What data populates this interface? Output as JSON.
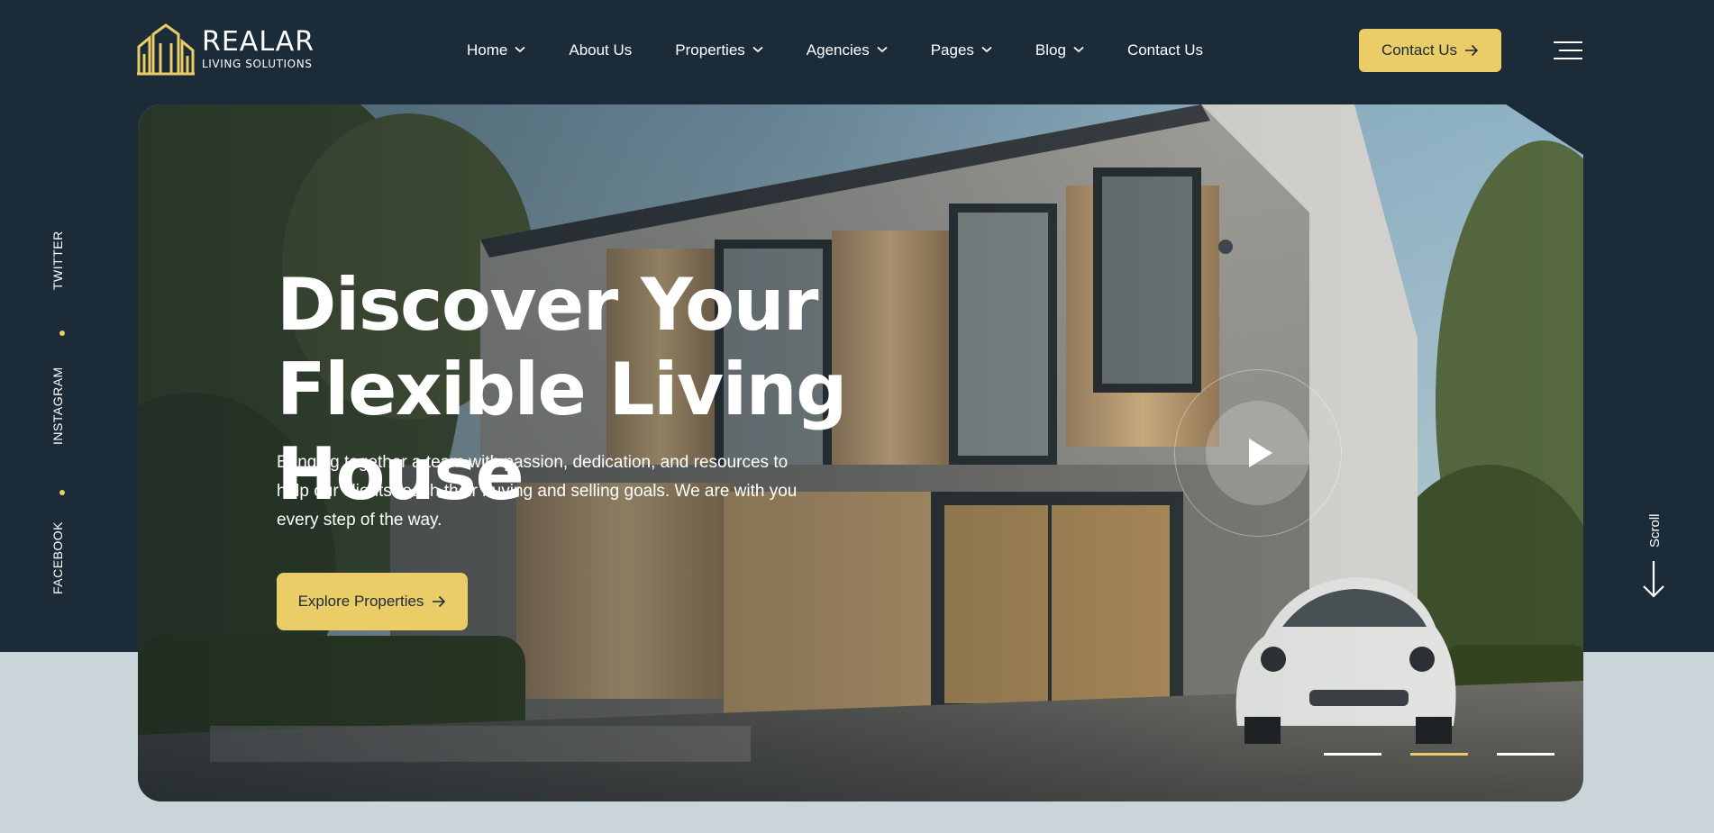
{
  "brand": {
    "name": "REALAR",
    "tagline": "LIVING SOLUTIONS",
    "accent_color": "#ebcd67",
    "dark_color": "#1b2b38"
  },
  "nav": {
    "items": [
      {
        "label": "Home",
        "has_dropdown": true
      },
      {
        "label": "About Us",
        "has_dropdown": false
      },
      {
        "label": "Properties",
        "has_dropdown": true
      },
      {
        "label": "Agencies",
        "has_dropdown": true
      },
      {
        "label": "Pages",
        "has_dropdown": true
      },
      {
        "label": "Blog",
        "has_dropdown": true
      },
      {
        "label": "Contact Us",
        "has_dropdown": false
      }
    ]
  },
  "header": {
    "cta_label": "Contact Us",
    "cta_icon": "arrow-right-icon",
    "menu_icon": "hamburger-menu-icon"
  },
  "social": {
    "links": [
      "TWITTER",
      "INSTAGRAM",
      "FACEBOOK"
    ]
  },
  "hero": {
    "title_line1": "Discover Your",
    "title_line2": "Flexible Living House",
    "description": "Bringing together a team with passion, dedication, and resources to help our clients reach their buying and selling goals. We are with you every step of the way.",
    "cta_label": "Explore Properties",
    "play_icon": "play-icon",
    "slides_total": 3,
    "active_slide": 2
  },
  "scroll": {
    "label": "Scroll",
    "icon": "arrow-down-icon"
  }
}
